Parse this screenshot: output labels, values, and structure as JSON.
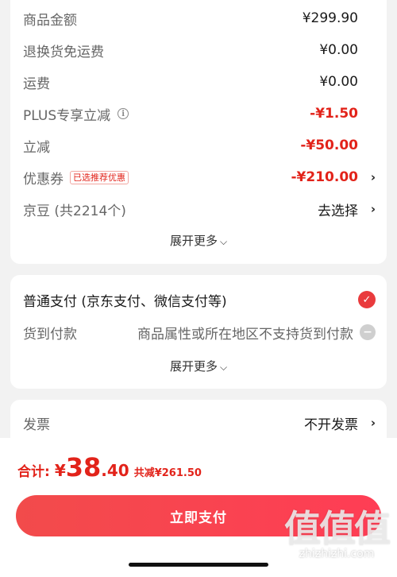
{
  "fees": {
    "rows": [
      {
        "label": "商品金额",
        "value": "¥299.90"
      },
      {
        "label": "退换货免运费",
        "value": "¥0.00"
      },
      {
        "label": "运费",
        "value": "¥0.00"
      },
      {
        "label": "PLUS专享立减",
        "value": "-¥1.50"
      },
      {
        "label": "立减",
        "value": "-¥50.00"
      },
      {
        "label": "优惠券",
        "tag": "已选推荐优惠",
        "value": "-¥210.00"
      },
      {
        "label": "京豆 (共2214个)",
        "value": "去选择"
      }
    ],
    "expand_label": "展开更多"
  },
  "payment": {
    "method_label": "普通支付 (京东支付、微信支付等)",
    "cod_label": "货到付款",
    "cod_note": "商品属性或所在地区不支持货到付款",
    "expand_label": "展开更多"
  },
  "invoice": {
    "label": "发票",
    "value": "不开发票"
  },
  "bottom": {
    "total_label": "合计:",
    "currency": "¥",
    "total_integer": "38",
    "total_decimal": ".40",
    "saved_text": "共减¥261.50",
    "pay_button_label": "立即支付"
  },
  "watermark": {
    "logo_text": "值值值",
    "site": "zhizhizhi.com"
  },
  "colors": {
    "accent_red": "#e2231a",
    "button_gradient_start": "#f24b4b",
    "button_gradient_end": "#ff3d55"
  }
}
